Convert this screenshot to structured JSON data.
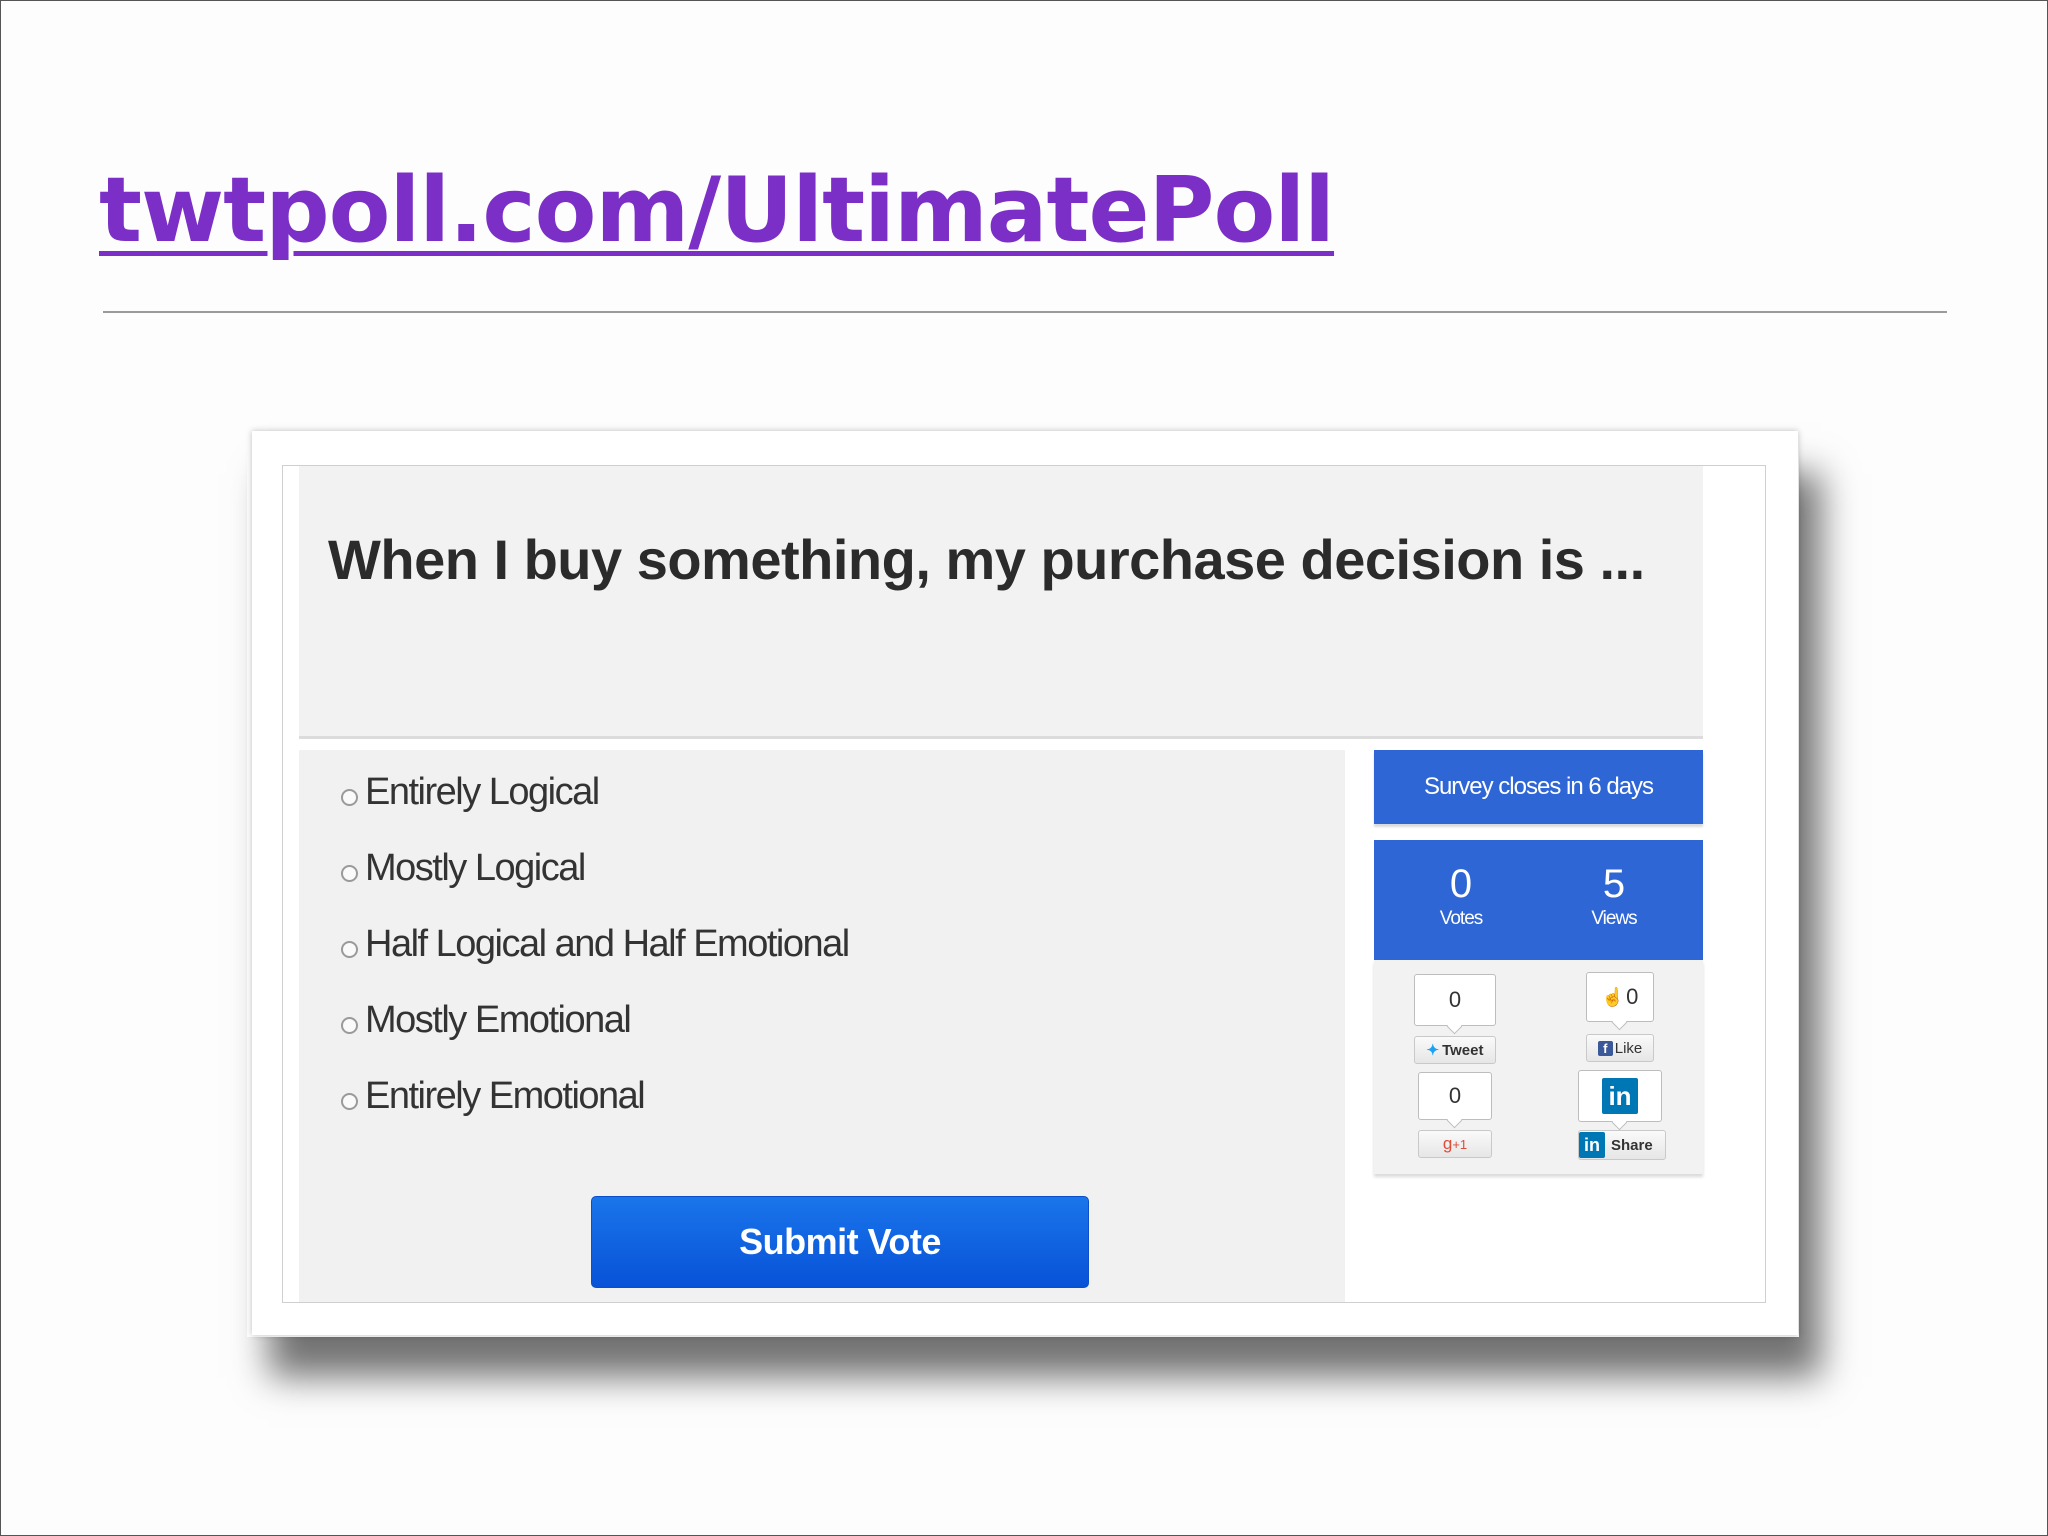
{
  "slide": {
    "title": "twtpoll.com/UltimatePoll"
  },
  "poll": {
    "question": "When I buy something, my purchase decision is ...",
    "options": [
      "Entirely Logical",
      "Mostly Logical",
      "Half Logical and Half Emotional",
      "Mostly Emotional",
      "Entirely Emotional"
    ],
    "submit_label": "Submit Vote"
  },
  "sidebar": {
    "survey_closes": "Survey closes in 6 days",
    "votes": {
      "value": "0",
      "label": "Votes"
    },
    "views": {
      "value": "5",
      "label": "Views"
    }
  },
  "social": {
    "tweet": {
      "count": "0",
      "label": "Tweet"
    },
    "facebook": {
      "count": "0",
      "label": "Like"
    },
    "gplus": {
      "count": "0",
      "label": "+1"
    },
    "linkedin": {
      "label": "Share",
      "icon_text": "in"
    }
  },
  "colors": {
    "title": "#7b2fc6",
    "accent_blue": "#2f66d6",
    "button_blue": "#0852d8"
  }
}
